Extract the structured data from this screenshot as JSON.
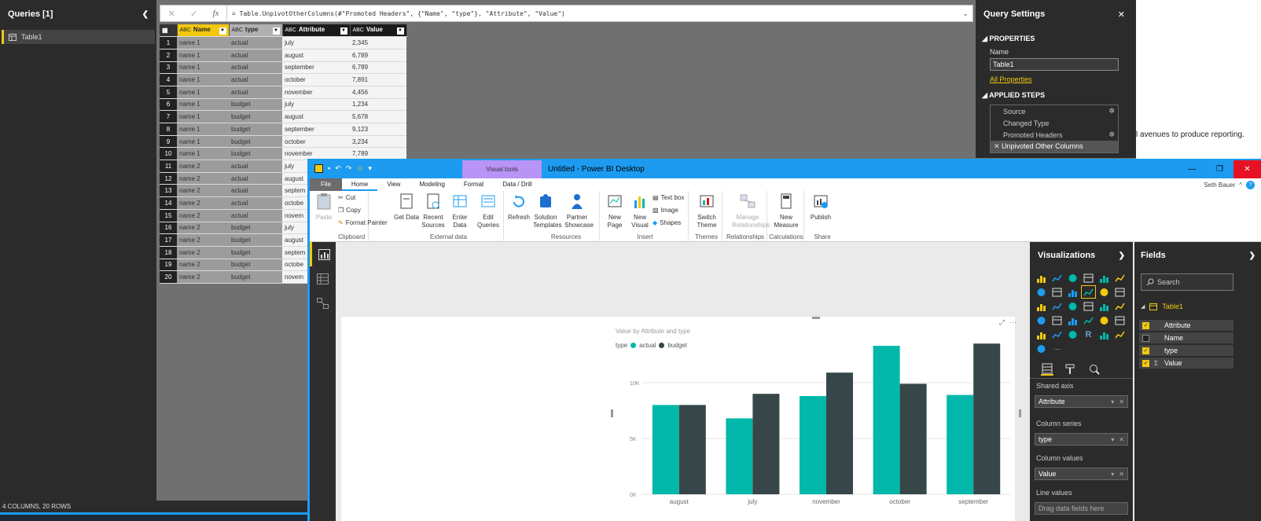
{
  "queries_pane": {
    "title": "Queries [1]",
    "collapse_glyph": "❮",
    "items": [
      {
        "label": "Table1",
        "icon": "table-icon"
      }
    ]
  },
  "formula_bar": {
    "cancel_glyph": "✕",
    "commit_glyph": "✓",
    "fx_label": "fx",
    "text": "= Table.UnpivotOtherColumns(#\"Promoted Headers\", {\"Name\", \"type\"}, \"Attribute\", \"Value\")"
  },
  "data_grid": {
    "columns": [
      {
        "type_icon": "ABC",
        "name": "Name"
      },
      {
        "type_icon": "ABC",
        "name": "type"
      },
      {
        "type_icon": "ABC",
        "name": "Attribute"
      },
      {
        "type_icon": "ABC",
        "name": "Value"
      }
    ],
    "rows": [
      [
        "1",
        "name 1",
        "actual",
        "july",
        "2,345"
      ],
      [
        "2",
        "name 1",
        "actual",
        "august",
        "6,789"
      ],
      [
        "3",
        "name 1",
        "actual",
        "september",
        "6,789"
      ],
      [
        "4",
        "name 1",
        "actual",
        "october",
        "7,891"
      ],
      [
        "5",
        "name 1",
        "actual",
        "november",
        "4,456"
      ],
      [
        "6",
        "name 1",
        "budget",
        "july",
        "1,234"
      ],
      [
        "7",
        "name 1",
        "budget",
        "august",
        "5,678"
      ],
      [
        "8",
        "name 1",
        "budget",
        "september",
        "9,123"
      ],
      [
        "9",
        "name 1",
        "budget",
        "october",
        "3,234"
      ],
      [
        "10",
        "name 1",
        "budget",
        "november",
        "7,789"
      ],
      [
        "11",
        "name 2",
        "actual",
        "july",
        ""
      ],
      [
        "12",
        "name 2",
        "actual",
        "august",
        ""
      ],
      [
        "13",
        "name 2",
        "actual",
        "septem",
        ""
      ],
      [
        "14",
        "name 2",
        "actual",
        "octobe",
        ""
      ],
      [
        "15",
        "name 2",
        "actual",
        "novem",
        ""
      ],
      [
        "16",
        "name 2",
        "budget",
        "july",
        ""
      ],
      [
        "17",
        "name 2",
        "budget",
        "august",
        ""
      ],
      [
        "18",
        "name 2",
        "budget",
        "septem",
        ""
      ],
      [
        "19",
        "name 2",
        "budget",
        "octobe",
        ""
      ],
      [
        "20",
        "name 2",
        "budget",
        "novem",
        ""
      ]
    ]
  },
  "status_bar": {
    "text": "4 COLUMNS, 20 ROWS"
  },
  "query_settings": {
    "title": "Query Settings",
    "close_glyph": "✕",
    "properties_header": "PROPERTIES",
    "name_label": "Name",
    "name_value": "Table1",
    "all_properties_link": "All Properties",
    "applied_steps_header": "APPLIED STEPS",
    "steps": [
      {
        "label": "Source",
        "has_gear": true
      },
      {
        "label": "Changed Type",
        "has_gear": false
      },
      {
        "label": "Promoted Headers",
        "has_gear": true
      },
      {
        "label": "Unpivoted Other Columns",
        "has_gear": false,
        "active": true
      }
    ]
  },
  "background_snippet": {
    "text": "l avenues to produce reporting."
  },
  "pbi_title": {
    "context_tab": "Visual tools",
    "window_title": "Untitled - Power BI Desktop",
    "minimize_glyph": "—",
    "maximize_glyph": "❐",
    "close_glyph": "✕"
  },
  "pbi_tabs": {
    "items": [
      "File",
      "Home",
      "View",
      "Modeling",
      "Format",
      "Data / Drill"
    ],
    "user": "Seth Bauer",
    "help_glyph": "?"
  },
  "ribbon": {
    "paste": "Paste",
    "cut": "Cut",
    "copy": "Copy",
    "format_painter": "Format Painter",
    "clipboard_group": "Clipboard",
    "get_data": "Get Data",
    "recent_sources": "Recent Sources",
    "enter_data": "Enter Data",
    "edit_queries": "Edit Queries",
    "external_group": "External data",
    "refresh": "Refresh",
    "solution_templates": "Solution Templates",
    "partner_showcase": "Partner Showcase",
    "resources_group": "Resources",
    "new_page": "New Page",
    "new_visual": "New Visual",
    "text_box": "Text box",
    "image": "Image",
    "shapes": "Shapes",
    "insert_group": "Insert",
    "switch_theme": "Switch Theme",
    "themes_group": "Themes",
    "manage_relationships": "Manage Relationships",
    "relationships_group": "Relationships",
    "new_measure": "New Measure",
    "calculations_group": "Calculations",
    "publish": "Publish",
    "share_group": "Share"
  },
  "visual": {
    "title": "Value by Attribute and type",
    "legend_label": "type",
    "focus_glyph": "⤢",
    "more_glyph": "···"
  },
  "chart_data": {
    "type": "bar",
    "title": "Value by Attribute and type",
    "categories": [
      "august",
      "july",
      "november",
      "october",
      "september"
    ],
    "series": [
      {
        "name": "actual",
        "color": "#01b8aa",
        "values": [
          8000,
          6800,
          8800,
          13300,
          8900
        ]
      },
      {
        "name": "budget",
        "color": "#374649",
        "values": [
          8000,
          9000,
          10900,
          9900,
          13500
        ]
      }
    ],
    "y_ticks": [
      "0K",
      "5K",
      "10K"
    ],
    "ylim": [
      0,
      15000
    ],
    "legend": "top-left",
    "grid": true
  },
  "viz_pane": {
    "title": "Visualizations",
    "chevron": "❯",
    "shared_axis_label": "Shared axis",
    "shared_axis_value": "Attribute",
    "column_series_label": "Column series",
    "column_series_value": "type",
    "column_values_label": "Column values",
    "column_values_value": "Value",
    "line_values_label": "Line values",
    "line_values_placeholder": "Drag data fields here",
    "well_dropdown_glyph": "▾",
    "well_remove_glyph": "✕",
    "more_glyph": "···",
    "r_label": "R"
  },
  "fields_pane": {
    "title": "Fields",
    "chevron": "❯",
    "search_placeholder": "Search",
    "table_name": "Table1",
    "expand_glyph": "◢",
    "sigma_glyph": "Σ",
    "check_glyph": "✓",
    "items": [
      {
        "label": "Attribute",
        "checked": true
      },
      {
        "label": "Name",
        "checked": false
      },
      {
        "label": "type",
        "checked": true
      },
      {
        "label": "Value",
        "checked": true,
        "sigma": true
      }
    ]
  },
  "colors": {
    "accent_yellow": "#f2c811",
    "accent_blue": "#1d9bf0",
    "teal": "#01b8aa",
    "dark_slate": "#374649"
  }
}
